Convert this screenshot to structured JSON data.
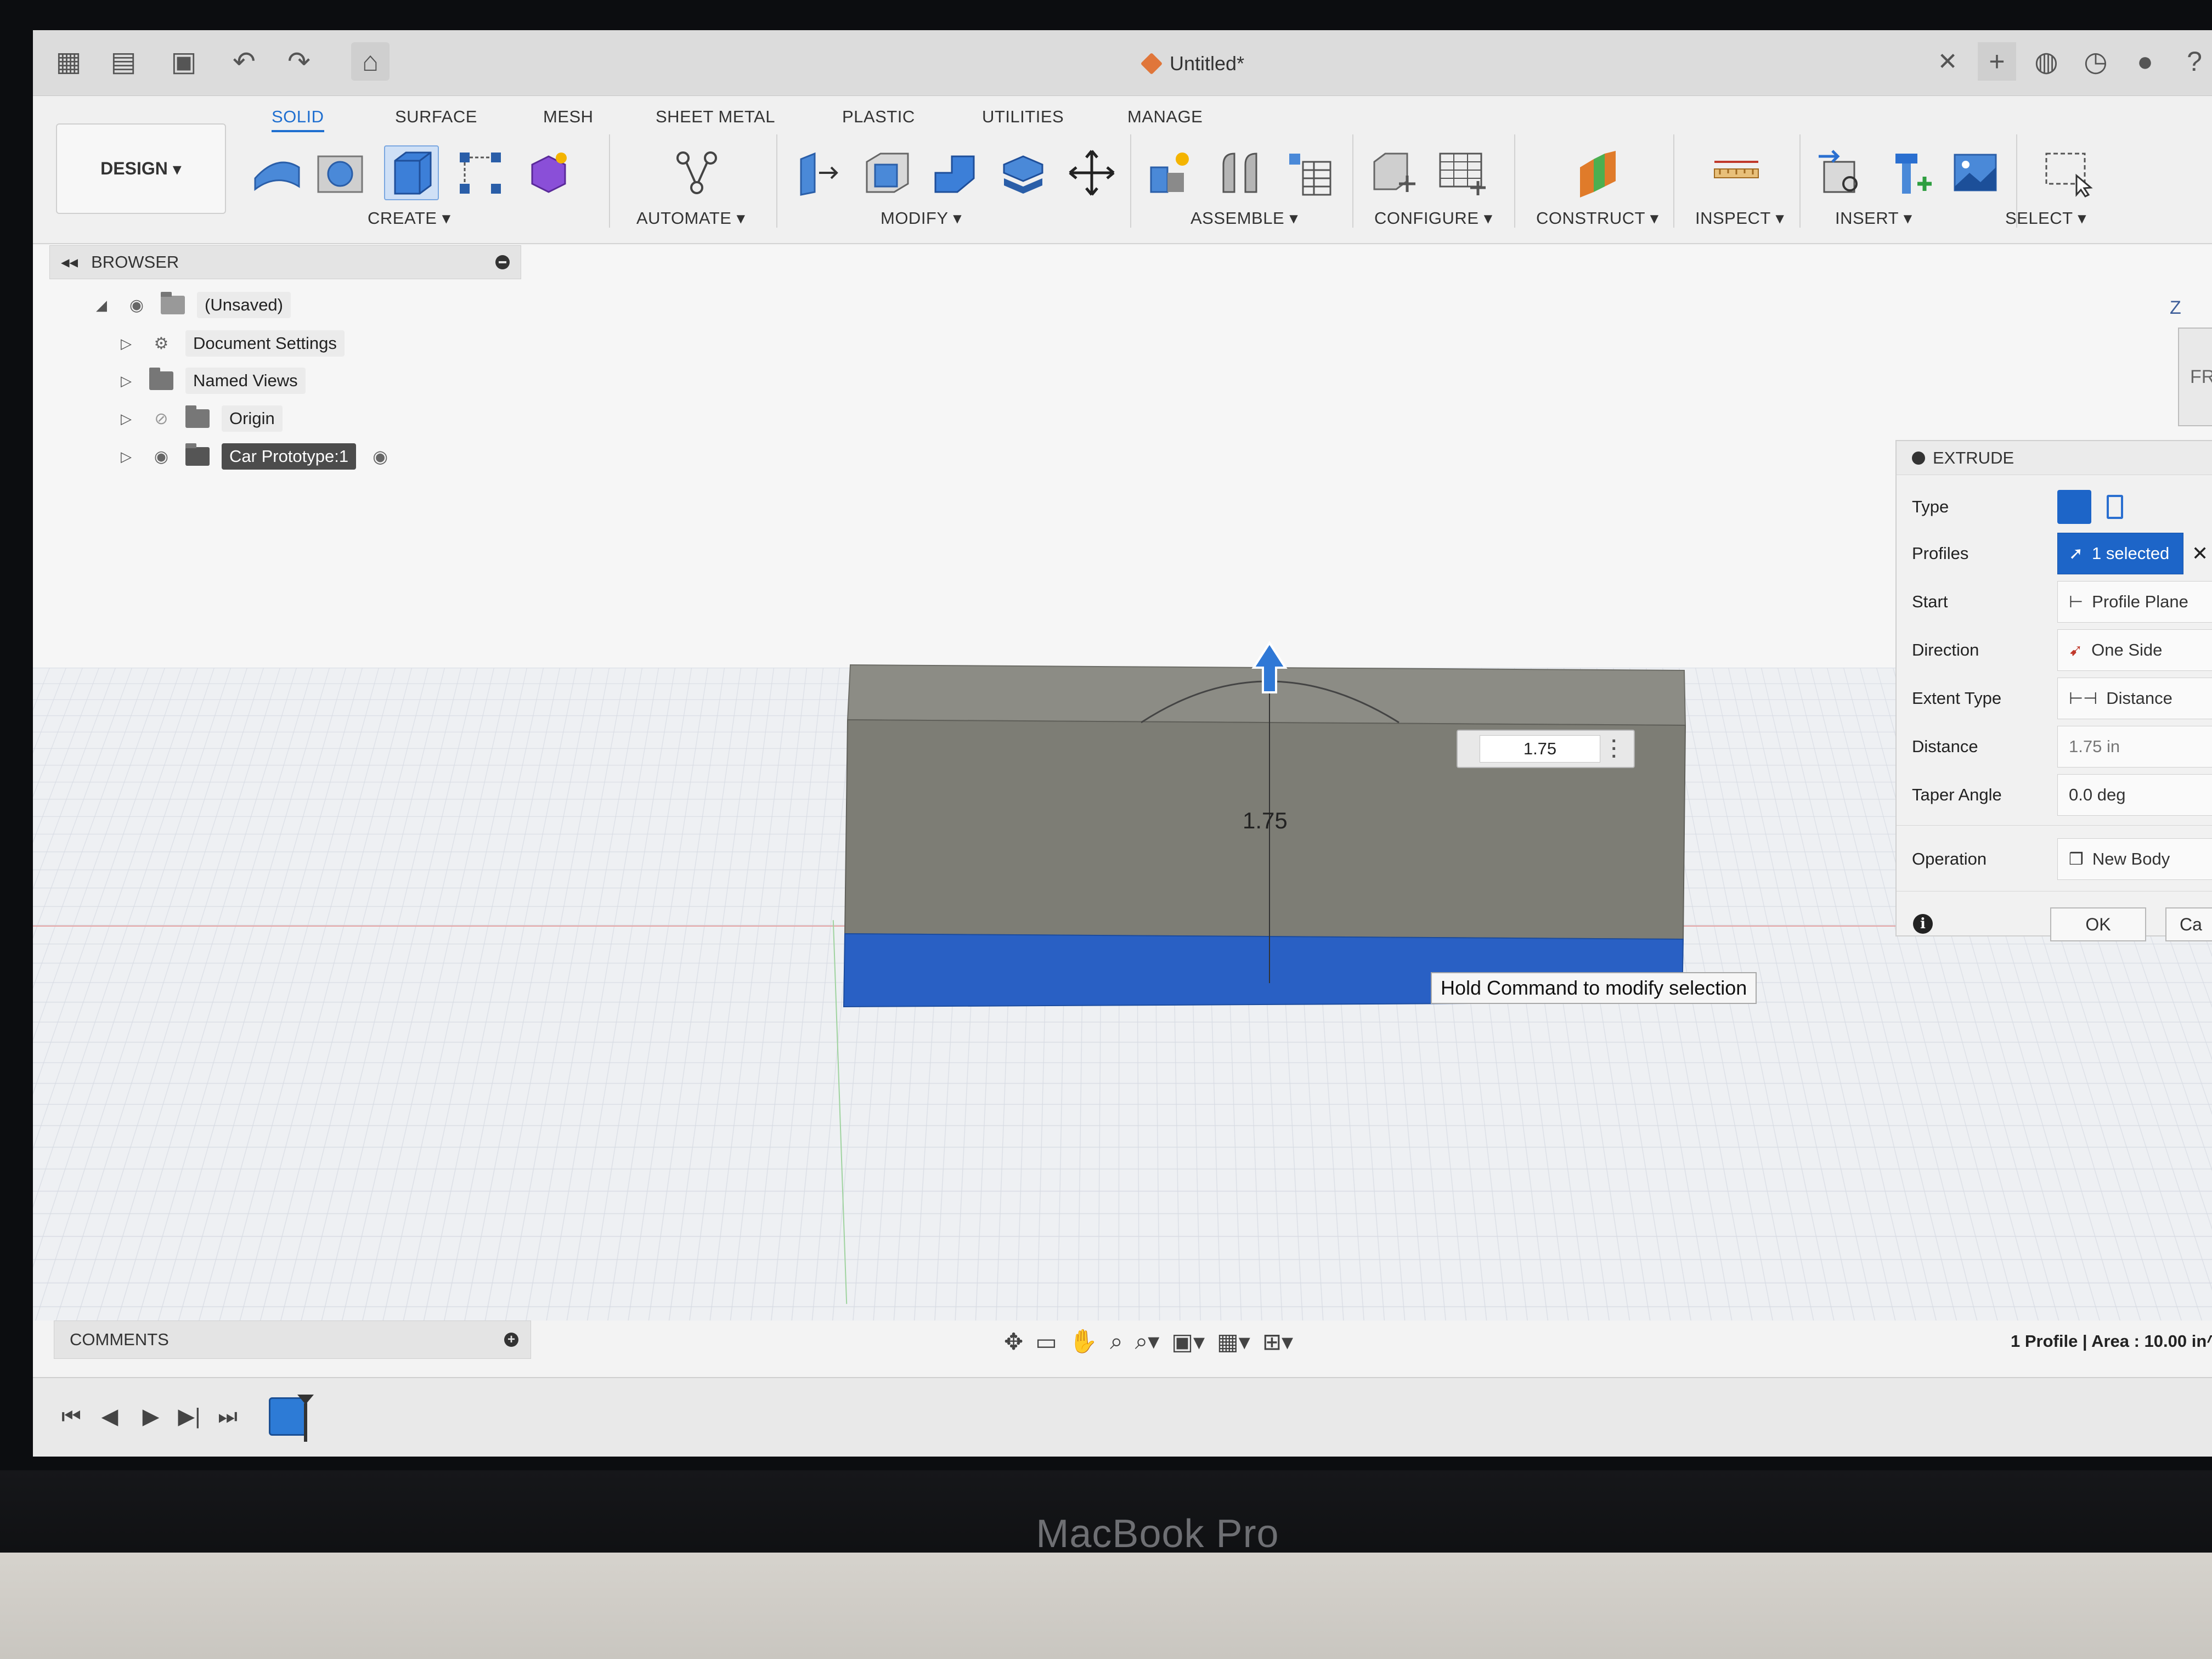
{
  "app": {
    "doc_title": "Untitled*"
  },
  "ribbon": {
    "workspace": "DESIGN",
    "tabs": [
      "SOLID",
      "SURFACE",
      "MESH",
      "SHEET METAL",
      "PLASTIC",
      "UTILITIES",
      "MANAGE"
    ],
    "groups": [
      "CREATE",
      "AUTOMATE",
      "MODIFY",
      "ASSEMBLE",
      "CONFIGURE",
      "CONSTRUCT",
      "INSPECT",
      "INSERT",
      "SELECT"
    ]
  },
  "browser": {
    "title": "BROWSER",
    "items": [
      {
        "label": "(Unsaved)"
      },
      {
        "label": "Document Settings"
      },
      {
        "label": "Named Views"
      },
      {
        "label": "Origin"
      },
      {
        "label": "Car Prototype:1"
      }
    ]
  },
  "viewport": {
    "dimension_label": "1.75",
    "dimension_input": "1.75",
    "tooltip": "Hold Command to modify selection",
    "viewcube_face": "FRONT",
    "viewcube_axis": "Z",
    "body_color": "#7d7d75",
    "profile_color": "#2960c4"
  },
  "extrude": {
    "title": "EXTRUDE",
    "rows": [
      {
        "label": "Type",
        "value": ""
      },
      {
        "label": "Profiles",
        "value": "1 selected"
      },
      {
        "label": "Start",
        "value": "Profile Plane"
      },
      {
        "label": "Direction",
        "value": "One Side"
      },
      {
        "label": "Extent Type",
        "value": "Distance"
      },
      {
        "label": "Distance",
        "value": "1.75 in"
      },
      {
        "label": "Taper Angle",
        "value": "0.0 deg"
      },
      {
        "label": "Operation",
        "value": "New Body"
      }
    ],
    "ok": "OK",
    "cancel": "Ca"
  },
  "comments": {
    "title": "COMMENTS"
  },
  "status": {
    "text": "1 Profile | Area : 10.00 in^2"
  },
  "hardware": {
    "brand": "MacBook Pro"
  }
}
